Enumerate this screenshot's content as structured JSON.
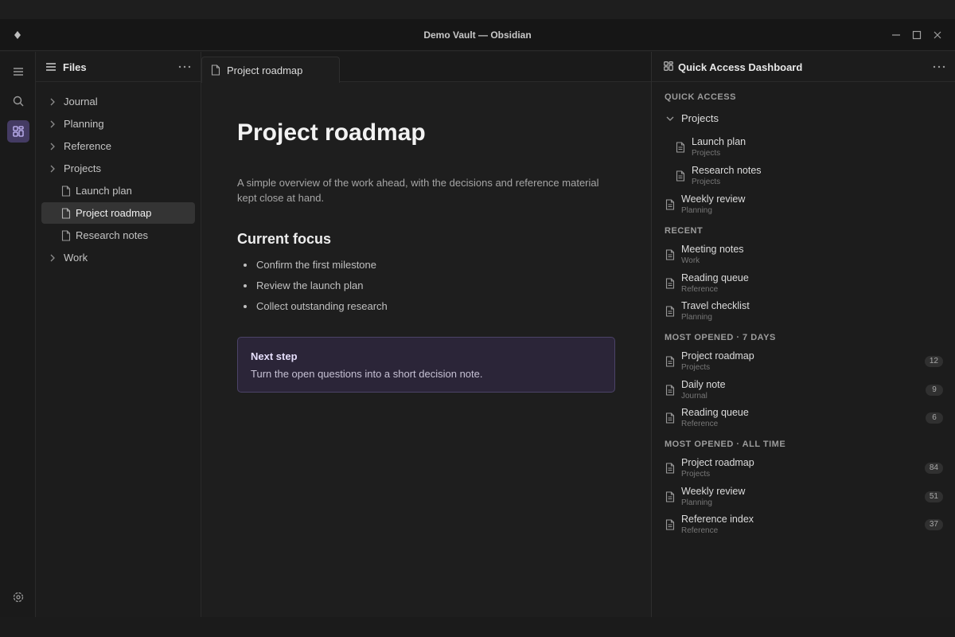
{
  "window": {
    "title": "Demo Vault — Obsidian"
  },
  "files": {
    "title": "Files",
    "items": [
      {
        "label": "Journal",
        "kind": "folder"
      },
      {
        "label": "Planning",
        "kind": "folder"
      },
      {
        "label": "Reference",
        "kind": "folder"
      },
      {
        "label": "Projects",
        "kind": "folder"
      },
      {
        "label": "Launch plan",
        "kind": "file"
      },
      {
        "label": "Project roadmap",
        "kind": "file",
        "selected": true
      },
      {
        "label": "Research notes",
        "kind": "file"
      },
      {
        "label": "Work",
        "kind": "folder"
      }
    ]
  },
  "editor": {
    "tab_label": "Project roadmap",
    "title": "Project roadmap",
    "intro": "A simple overview of the work ahead, with the decisions and reference material kept close at hand.",
    "heading": "Current focus",
    "bullets": [
      "Confirm the first milestone",
      "Review the launch plan",
      "Collect outstanding research"
    ],
    "callout": {
      "title": "Next step",
      "text": "Turn the open questions into a short decision note."
    }
  },
  "dashboard": {
    "title": "Quick Access Dashboard",
    "quick_access": {
      "label": "QUICK ACCESS",
      "group": "Projects",
      "group_items": [
        {
          "name": "Launch plan",
          "folder": "Projects"
        },
        {
          "name": "Research notes",
          "folder": "Projects"
        }
      ],
      "items": [
        {
          "name": "Weekly review",
          "folder": "Planning"
        }
      ]
    },
    "recent": {
      "label": "RECENT",
      "items": [
        {
          "name": "Meeting notes",
          "folder": "Work"
        },
        {
          "name": "Reading queue",
          "folder": "Reference"
        },
        {
          "name": "Travel checklist",
          "folder": "Planning"
        }
      ]
    },
    "most_7": {
      "label": "MOST OPENED · 7 DAYS",
      "items": [
        {
          "name": "Project roadmap",
          "folder": "Projects",
          "count": "12"
        },
        {
          "name": "Daily note",
          "folder": "Journal",
          "count": "9"
        },
        {
          "name": "Reading queue",
          "folder": "Reference",
          "count": "6"
        }
      ]
    },
    "most_all": {
      "label": "MOST OPENED · ALL TIME",
      "items": [
        {
          "name": "Project roadmap",
          "folder": "Projects",
          "count": "84"
        },
        {
          "name": "Weekly review",
          "folder": "Planning",
          "count": "51"
        },
        {
          "name": "Reference index",
          "folder": "Reference",
          "count": "37"
        }
      ]
    }
  },
  "colors": {
    "accent": "#8b7cf0",
    "accent_bg": "#443b63",
    "callout_bg": "#2b2538"
  }
}
